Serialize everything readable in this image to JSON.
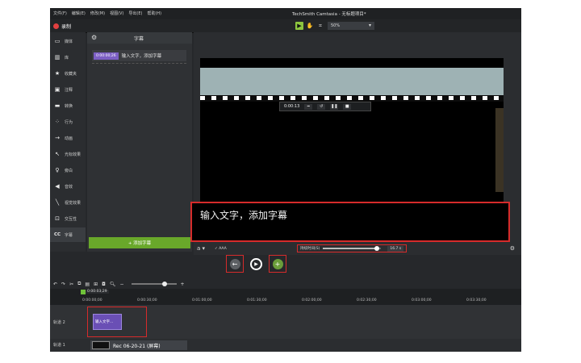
{
  "menubar": {
    "items": [
      "文件(F)",
      "编辑(E)",
      "修改(M)",
      "视图(V)",
      "导出(E)",
      "帮助(H)"
    ],
    "window_title": "TechSmith Camtasia - 无标题项目*"
  },
  "toolbar": {
    "record_label": "录制",
    "zoom_value": "50%"
  },
  "sidebar": {
    "items": [
      {
        "label": "媒体",
        "icon": "media-icon"
      },
      {
        "label": "库",
        "icon": "library-icon"
      },
      {
        "label": "收藏夹",
        "icon": "star-icon"
      },
      {
        "label": "注释",
        "icon": "annotation-icon"
      },
      {
        "label": "转换",
        "icon": "transition-icon"
      },
      {
        "label": "行为",
        "icon": "behavior-icon"
      },
      {
        "label": "动画",
        "icon": "animation-icon"
      },
      {
        "label": "光标效果",
        "icon": "cursor-icon"
      },
      {
        "label": "旁白",
        "icon": "mic-icon"
      },
      {
        "label": "音效",
        "icon": "audio-icon"
      },
      {
        "label": "视觉效果",
        "icon": "visual-effects-icon"
      },
      {
        "label": "交互性",
        "icon": "interactivity-icon"
      },
      {
        "label": "字幕",
        "icon": "cc-icon"
      }
    ]
  },
  "captions_panel": {
    "title": "字幕",
    "items": [
      {
        "time": "0:00:00;26",
        "text": "输入文字，添加字幕"
      }
    ],
    "add_button": "+ 添加字幕"
  },
  "canvas": {
    "playback_time": "0:00:13",
    "caption_text": "输入文字，添加字幕"
  },
  "caption_controls": {
    "aa_label": "✓ AAA",
    "duration_label": "持续时间(S)",
    "duration_value": "16.7 s",
    "duration_fraction": 0.92
  },
  "timeline": {
    "playhead_time": "0:00:03;29",
    "ticks": [
      "0:00:00;00",
      "0:00:30;00",
      "0:01:00;00",
      "0:01:30;00",
      "0:02:00;00",
      "0:02:30;00",
      "0:03:00;00",
      "0:03:30;00"
    ],
    "markers_label": "标记",
    "track2_label": "轨道 2",
    "track1_label": "轨道 1",
    "caption_clip_text": "输入文字...",
    "media_clip_text": "Rec 06-20-21 (屏幕)"
  }
}
